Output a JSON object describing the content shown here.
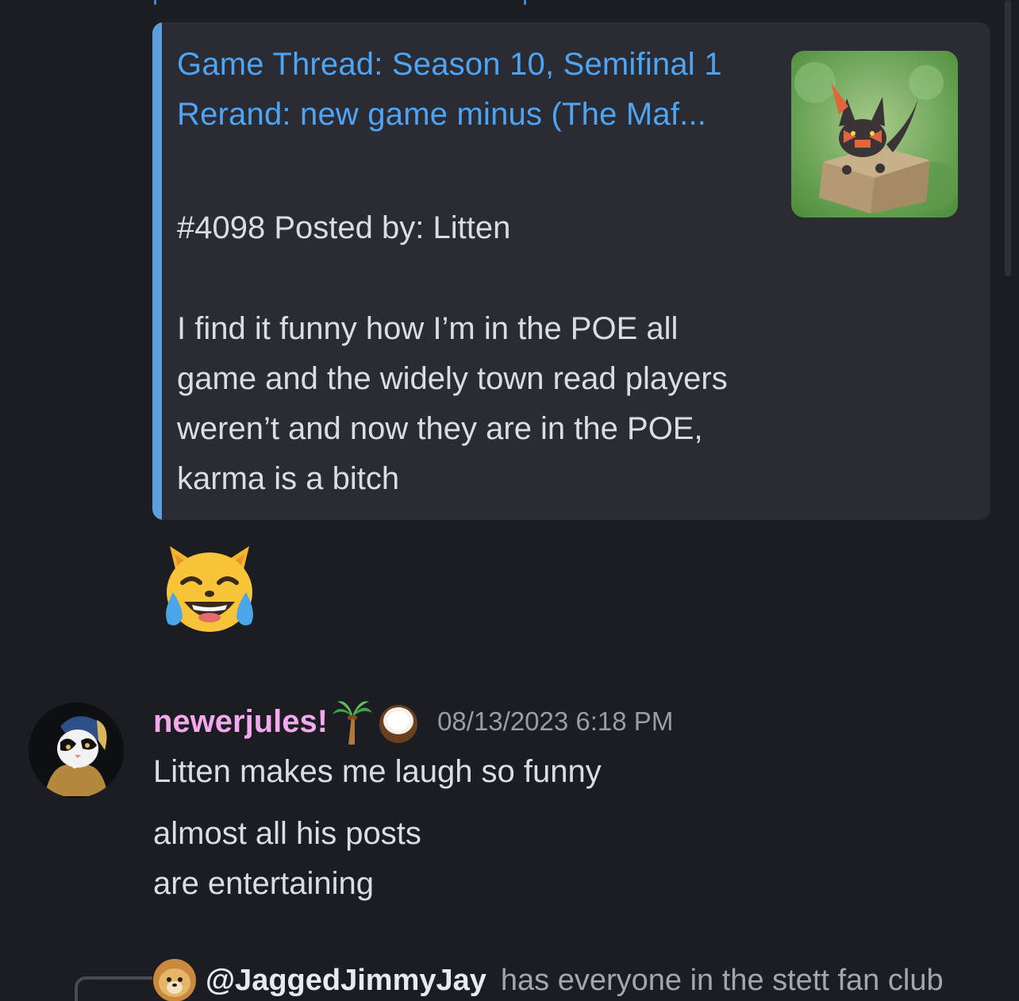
{
  "embed": {
    "title": "Game Thread: Season 10, Semifinal 1 Rerand: new game minus (The Maf...",
    "meta": "#4098 Posted by: Litten",
    "body": "I find it funny how I’m in the POE all game and the widely town read players weren’t and now they are in the POE, karma is a bitch",
    "accent_color": "#5b9fdc",
    "link_color": "#4ea4f5"
  },
  "reaction": {
    "icon": "joy-cat-emoji"
  },
  "message": {
    "username": "newerjules!",
    "username_emojis": [
      "palm-tree-emoji",
      "coconut-emoji"
    ],
    "timestamp": "08/13/2023 6:18 PM",
    "lines": [
      "Litten makes me laugh so funny",
      "almost all his posts",
      "are entertaining"
    ],
    "avatar_icon": "cat-avatar"
  },
  "reply": {
    "mention": "@JaggedJimmyJay",
    "text": "has everyone in the stett fan club",
    "avatar_icon": "dog-avatar"
  }
}
